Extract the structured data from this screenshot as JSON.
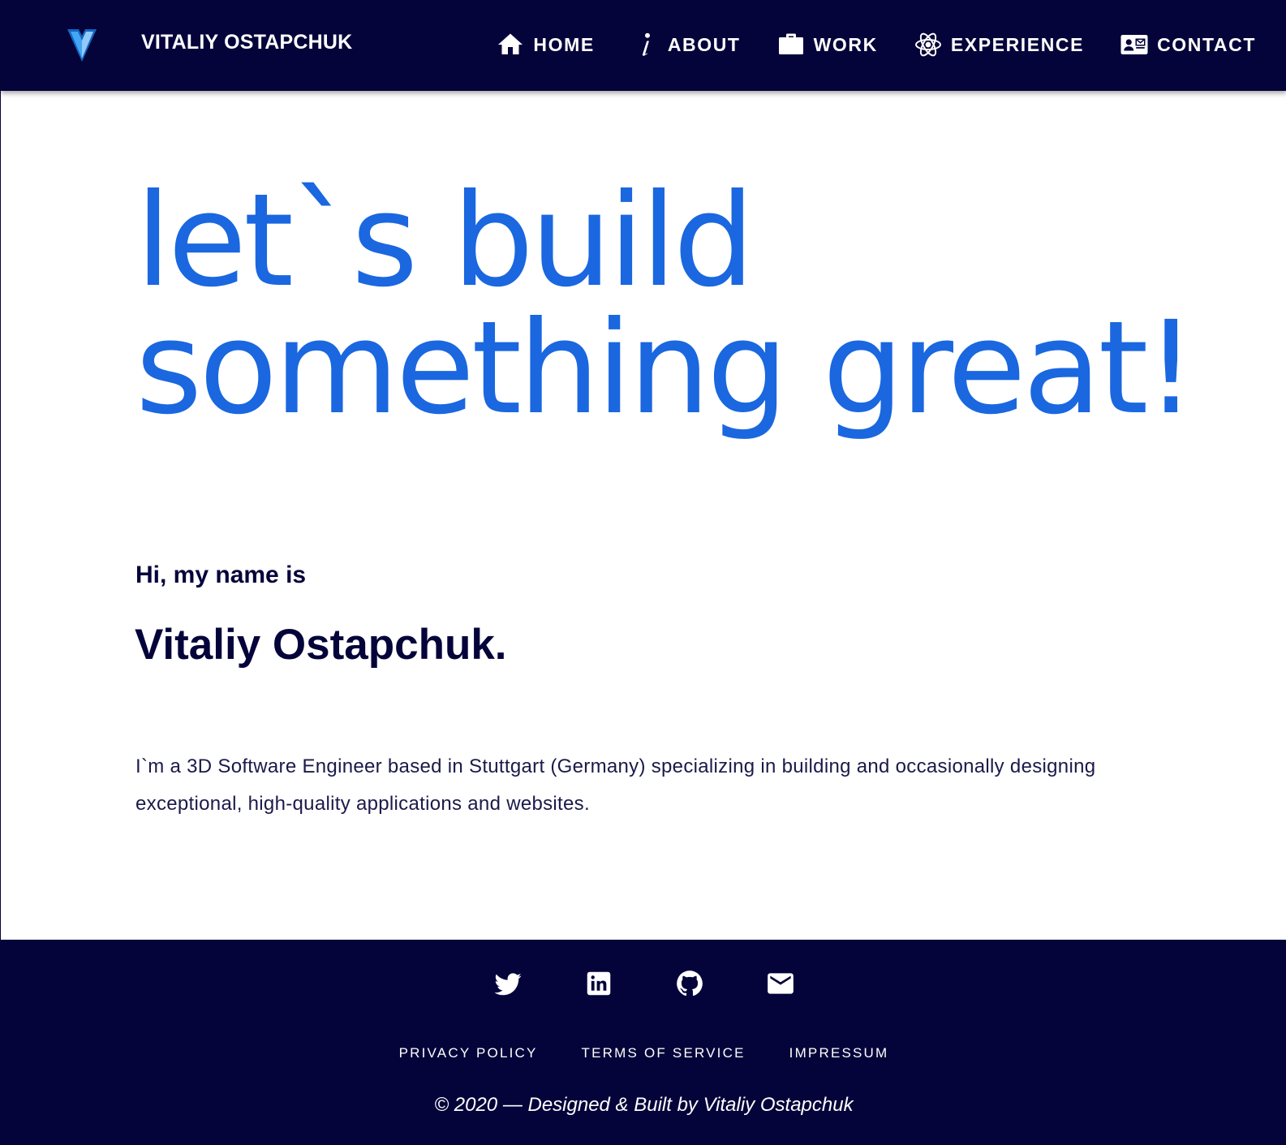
{
  "header": {
    "brand": "VITALIY OSTAPCHUK",
    "logo_icon": "vuetify-v-logo",
    "nav": [
      {
        "label": "HOME",
        "icon": "home-icon"
      },
      {
        "label": "ABOUT",
        "icon": "info-icon"
      },
      {
        "label": "WORK",
        "icon": "briefcase-icon"
      },
      {
        "label": "EXPERIENCE",
        "icon": "atom-icon"
      },
      {
        "label": "CONTACT",
        "icon": "contact-card-icon"
      }
    ]
  },
  "hero": {
    "line1": "let`s build",
    "line2": "something great!"
  },
  "intro": {
    "greeting": "Hi, my name is",
    "name": "Vitaliy Ostapchuk.",
    "bio": "I`m a 3D Software Engineer based in Stuttgart (Germany) specializing in building and occasionally designing exceptional, high-quality applications and websites."
  },
  "footer": {
    "social": [
      {
        "icon": "twitter-icon"
      },
      {
        "icon": "linkedin-icon"
      },
      {
        "icon": "github-icon"
      },
      {
        "icon": "email-icon"
      }
    ],
    "links": [
      "PRIVACY POLICY",
      "TERMS OF SERVICE",
      "IMPRESSUM"
    ],
    "copyright": "© 2020 — Designed & Built by Vitaliy Ostapchuk"
  },
  "colors": {
    "navy": "#05043a",
    "accent_blue": "#1a67e0",
    "white": "#ffffff"
  }
}
